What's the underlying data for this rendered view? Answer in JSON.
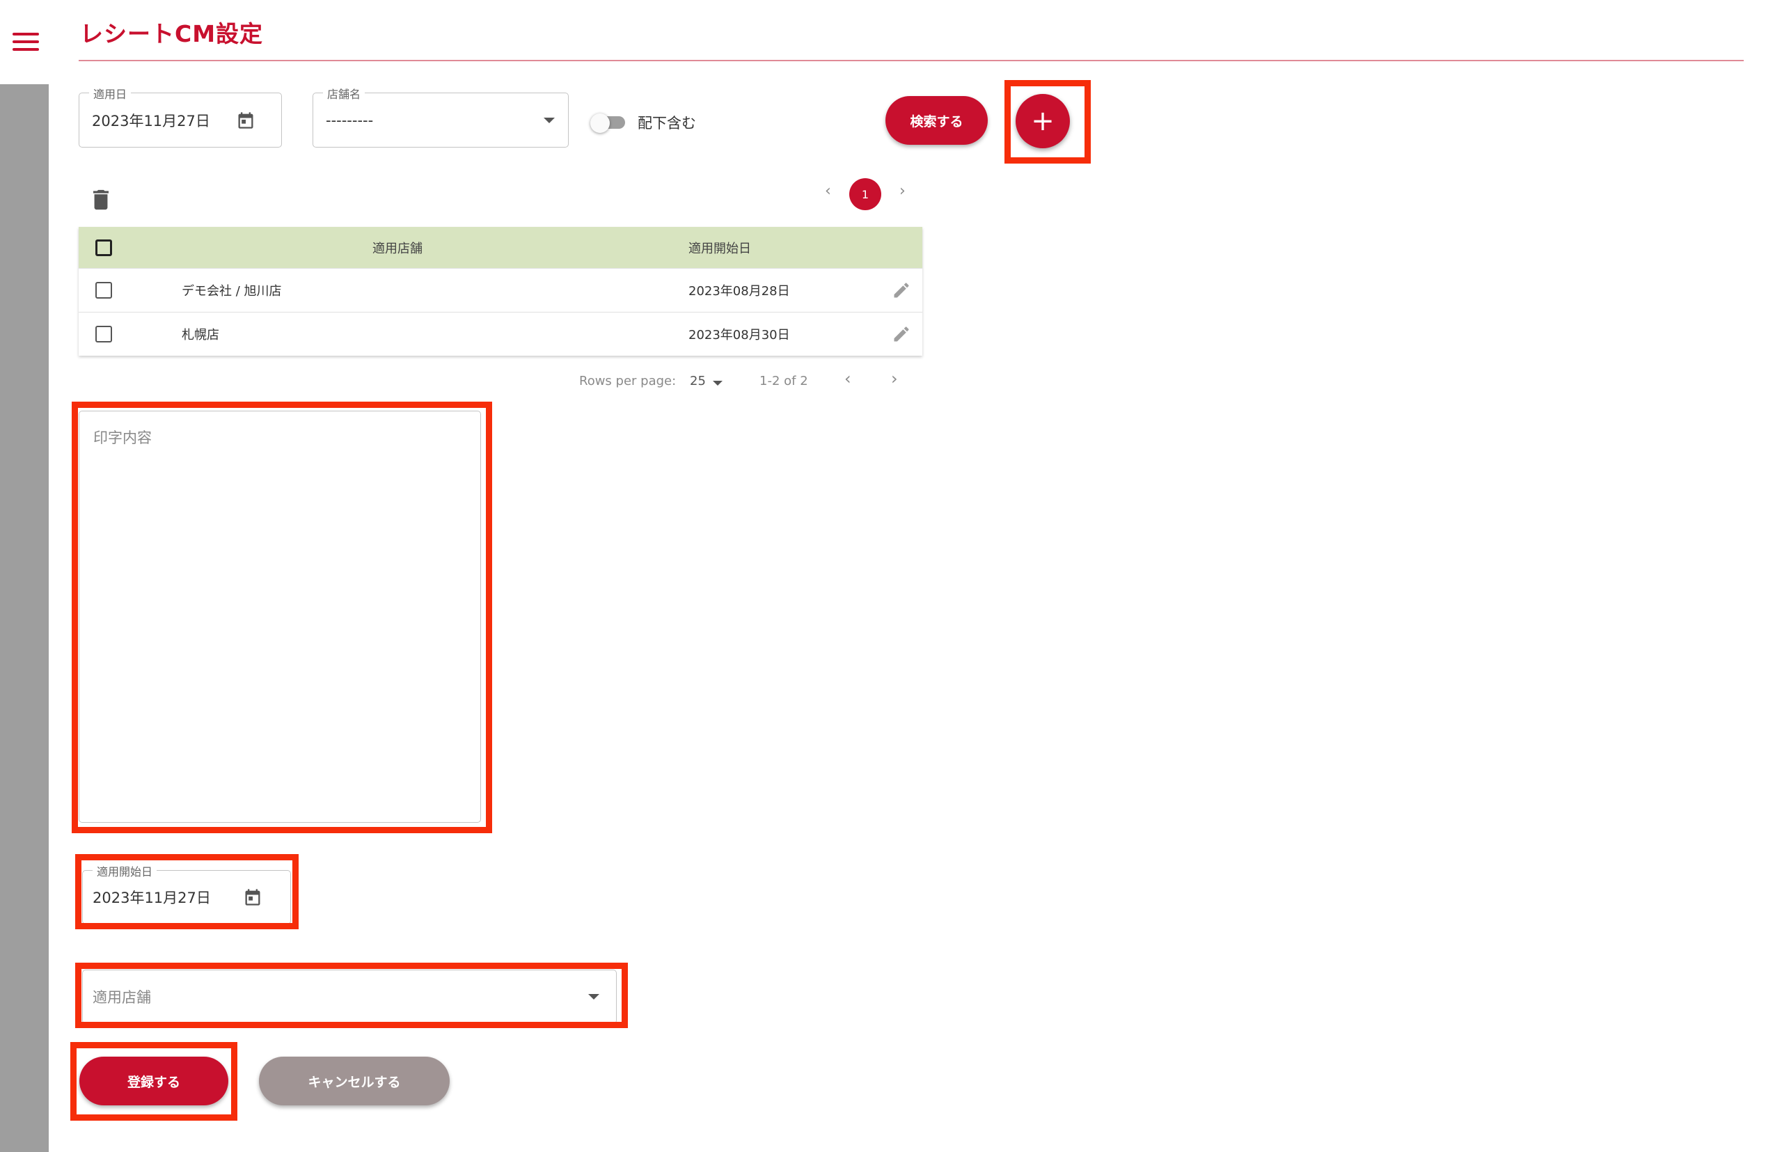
{
  "header": {
    "title": "レシートCM設定"
  },
  "filters": {
    "date_label": "適用日",
    "date_value": "2023年11月27日",
    "store_label": "店舗名",
    "store_value": "---------",
    "toggle_label": "配下含む",
    "search_label": "検索する",
    "add_label": "+"
  },
  "pagination_top": {
    "current_page": "1",
    "prev": "‹",
    "next": "›"
  },
  "table": {
    "headers": [
      "適用店舗",
      "適用開始日"
    ],
    "rows": [
      {
        "store": "デモ会社 / 旭川店",
        "start_date": "2023年08月28日"
      },
      {
        "store": "札幌店",
        "start_date": "2023年08月30日"
      }
    ],
    "footer": {
      "rows_per_page_label": "Rows per page:",
      "rows_per_page_value": "25",
      "range": "1-2 of 2",
      "prev": "‹",
      "next": "›"
    }
  },
  "form": {
    "print_content_placeholder": "印字内容",
    "start_date_label": "適用開始日",
    "start_date_value": "2023年11月27日",
    "store_placeholder": "適用店舗",
    "register_label": "登録する",
    "cancel_label": "キャンセルする"
  },
  "colors": {
    "accent": "#c8102e",
    "highlight": "#f62d0a",
    "table_header": "#d8e4c0",
    "cancel": "#a09494"
  }
}
